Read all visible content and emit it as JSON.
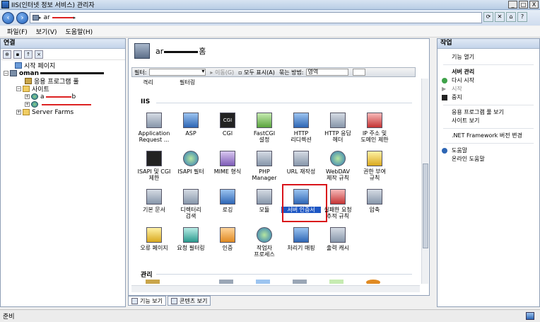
{
  "window": {
    "title": "IIS(인터넷 정보 서비스) 관리자",
    "controls": [
      "_",
      "□",
      "X"
    ]
  },
  "address": {
    "path": [
      "ar",
      ""
    ]
  },
  "menu": [
    "파일(F)",
    "보기(V)",
    "도움말(H)"
  ],
  "connections": {
    "title": "연결",
    "tree": {
      "start_page": "시작 페이지",
      "server": "oman",
      "app_pools": "응용 프로그램 풀",
      "sites": "사이트",
      "site1": "a",
      "site1_suffix": "b",
      "server_farms": "Server Farms"
    }
  },
  "center": {
    "title_prefix": "ar",
    "title_suffix": "홈",
    "filter": {
      "label": "필터:",
      "go": "이동(G)",
      "show_all": "모두 표시(A)",
      "group_by": "묶는 방법:",
      "group_value": "영역"
    },
    "partial_row": [
      "격리",
      "필터링",
      ""
    ],
    "sections": {
      "iis": "IIS",
      "management": "관리"
    },
    "icons": [
      {
        "label": "Application\nRequest ..."
      },
      {
        "label": "ASP"
      },
      {
        "label": "CGI",
        "glyph": "CGI"
      },
      {
        "label": "FastCGI\n설정"
      },
      {
        "label": "HTTP\n리디렉션"
      },
      {
        "label": "HTTP 응답\n헤더"
      },
      {
        "label": "IP 주소 및\n도메인 제한"
      },
      {
        "label": "ISAPI 및 CGI\n제한"
      },
      {
        "label": "ISAPI 필터"
      },
      {
        "label": "MIME 형식"
      },
      {
        "label": "PHP\nManager"
      },
      {
        "label": "URL 재작성"
      },
      {
        "label": "WebDAV\n제작 규칙"
      },
      {
        "label": "권한 부여\n규칙"
      },
      {
        "label": "기본 문서"
      },
      {
        "label": "디렉터리\n검색"
      },
      {
        "label": "로깅"
      },
      {
        "label": "모듈"
      },
      {
        "label": "서버 인증서"
      },
      {
        "label": "실패한 요청\n추적 규칙"
      },
      {
        "label": "압축"
      },
      {
        "label": "오류 페이지"
      },
      {
        "label": "요청 필터링"
      },
      {
        "label": "인증"
      },
      {
        "label": "작업자\n프로세스"
      },
      {
        "label": "처리기 매핑"
      },
      {
        "label": "출력 캐시"
      }
    ],
    "tabs": [
      "기능 보기",
      "콘텐츠 보기"
    ]
  },
  "actions": {
    "title": "작업",
    "open_feature": "기능 열기",
    "server_mgmt": "서버 관리",
    "restart": "다시 시작",
    "start": "시작",
    "stop": "중지",
    "view_app_pools": "응용 프로그램 풀 보기",
    "view_sites": "사이트 보기",
    "change_net": ".NET Framework 버전 변경",
    "help": "도움말",
    "online_help": "온라인 도움말"
  },
  "status": {
    "text": "준비"
  }
}
